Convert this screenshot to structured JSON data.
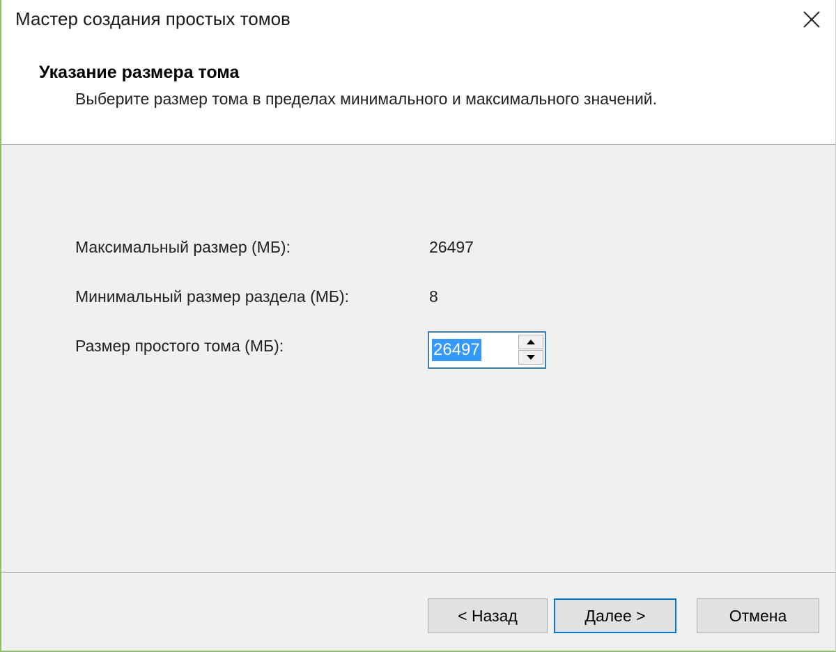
{
  "window": {
    "title": "Мастер создания простых томов"
  },
  "header": {
    "heading": "Указание размера тома",
    "subheading": "Выберите размер тома в пределах минимального и максимального значений."
  },
  "fields": {
    "max_size_label": "Максимальный размер (МБ):",
    "max_size_value": "26497",
    "min_size_label": "Минимальный размер раздела (МБ):",
    "min_size_value": "8",
    "volume_size_label": "Размер простого тома (МБ):",
    "volume_size_value": "26497"
  },
  "buttons": {
    "back": "< Назад",
    "next": "Далее >",
    "cancel": "Отмена"
  },
  "icons": {
    "close": "close-icon",
    "spin_up": "arrow-up-icon",
    "spin_down": "arrow-down-icon"
  },
  "colors": {
    "selection": "#3399ff",
    "focus_border": "#0078d7",
    "window_border": "#8cbf6a"
  }
}
